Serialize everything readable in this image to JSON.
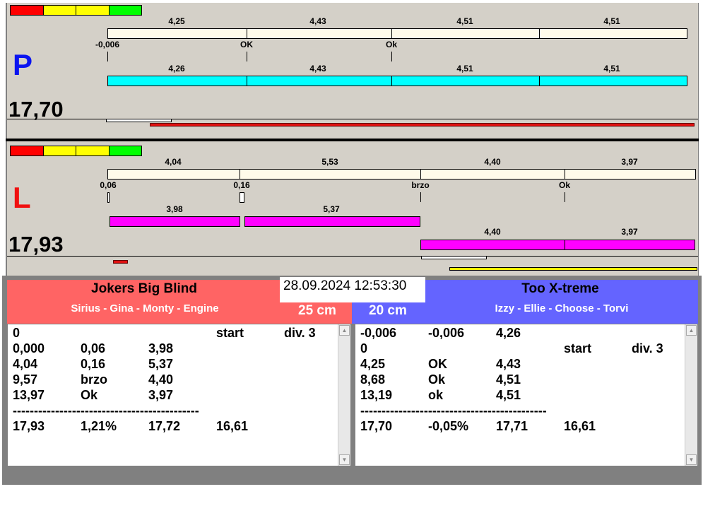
{
  "colors": {
    "red": "#ff0000",
    "yellow": "#ffff00",
    "green": "#00ff00",
    "cream": "#fffbea",
    "cyan": "#00ffff",
    "magenta": "#ff00ff",
    "left_header": "#ff6464",
    "right_header": "#6464ff"
  },
  "top_panel": {
    "letter": "P",
    "total": "17,70",
    "row1_labels": [
      "4,25",
      "4,43",
      "4,51",
      "4,51"
    ],
    "marks": [
      "-0,006",
      "OK",
      "Ok"
    ],
    "row2_labels": [
      "4,26",
      "4,43",
      "4,51",
      "4,51"
    ]
  },
  "bottom_panel": {
    "letter": "L",
    "total": "17,93",
    "row1_labels": [
      "4,04",
      "5,53",
      "4,40",
      "3,97"
    ],
    "marks": [
      "0,06",
      "0,16",
      "brzo",
      "Ok"
    ],
    "row2_labels": [
      "3,98",
      "5,37"
    ],
    "row3_labels": [
      "4,40",
      "3,97"
    ]
  },
  "datetime": "28.09.2024 12:53:30",
  "left_team": {
    "name": "Jokers Big Blind",
    "members": "Sirius - Gina - Monty - Engine",
    "height": "25 cm",
    "rows": [
      [
        "0",
        "",
        "",
        "start",
        "div. 3"
      ],
      [
        "0,000",
        "0,06",
        "3,98",
        "",
        ""
      ],
      [
        "4,04",
        "0,16",
        "5,37",
        "",
        ""
      ],
      [
        "9,57",
        "brzo",
        "4,40",
        "",
        ""
      ],
      [
        "13,97",
        "Ok",
        "3,97",
        "",
        ""
      ]
    ],
    "separator": "--------------------------------------------",
    "summary": [
      "17,93",
      "1,21%",
      "17,72",
      "16,61"
    ]
  },
  "right_team": {
    "name": "Too X-treme",
    "members": "Izzy - Ellie - Choose - Torvi",
    "height": "20 cm",
    "rows": [
      [
        "-0,006",
        "-0,006",
        "4,26",
        "",
        ""
      ],
      [
        "0",
        "",
        "",
        "start",
        "div. 3"
      ],
      [
        "4,25",
        "OK",
        "4,43",
        "",
        ""
      ],
      [
        "8,68",
        "Ok",
        "4,51",
        "",
        ""
      ],
      [
        "13,19",
        "ok",
        "4,51",
        "",
        ""
      ]
    ],
    "separator": "--------------------------------------------",
    "summary": [
      "17,70",
      "-0,05%",
      "17,71",
      "16,61"
    ]
  }
}
